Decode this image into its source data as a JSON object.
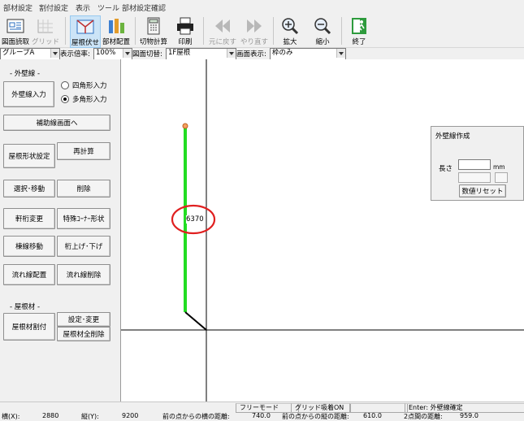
{
  "menubar": {
    "items": [
      "部材設定",
      "割付設定",
      "表示",
      "ツール",
      "部材設定確認"
    ]
  },
  "toolbar": {
    "buttons": [
      {
        "label": "図面読取",
        "icon": "drawing-read-icon",
        "state": "normal"
      },
      {
        "label": "グリッド",
        "icon": "grid-icon",
        "state": "disabled"
      },
      {
        "label": "屋根伏せ",
        "icon": "roof-plan-icon",
        "state": "pressed"
      },
      {
        "label": "部材配置",
        "icon": "member-placement-icon",
        "state": "normal"
      },
      {
        "label": "切物計算",
        "icon": "cut-calc-icon",
        "state": "normal"
      },
      {
        "label": "印刷",
        "icon": "printer-icon",
        "state": "normal"
      },
      {
        "label": "元に戻す",
        "icon": "undo-icon",
        "state": "disabled"
      },
      {
        "label": "やり直す",
        "icon": "redo-icon",
        "state": "disabled"
      },
      {
        "label": "拡大",
        "icon": "zoom-in-icon",
        "state": "normal"
      },
      {
        "label": "縮小",
        "icon": "zoom-out-icon",
        "state": "normal"
      },
      {
        "label": "終了",
        "icon": "exit-icon",
        "state": "normal"
      }
    ]
  },
  "combos": {
    "group": "グループA",
    "scale_label": "表示倍率:",
    "scale_value": "100%",
    "drawing_label": "図面切替:",
    "drawing_value": "1F屋根",
    "display_label": "画面表示:",
    "display_value": "枠のみ"
  },
  "leftpanel": {
    "wall_group_title": "- 外壁線 -",
    "wall_input": "外壁線入力",
    "radio_rect": "四角形入力",
    "radio_poly": "多角形入力",
    "aux_button": "補助線画面へ",
    "roof_shape": "屋根形状設定",
    "recalc": "再計算",
    "select_move": "選択･移動",
    "delete": "削除",
    "eave_change": "軒桁変更",
    "corner_shape": "特殊ｺｰﾅｰ形状",
    "ridge_move": "棟線移動",
    "beam_updown": "桁上げ･下げ",
    "flow_place": "流れ線配置",
    "flow_delete": "流れ線削除",
    "roofmat_title": "- 屋根材 -",
    "roofmat_alloc": "屋根材割付",
    "setting_change": "設定･変更",
    "roofmat_delete_all": "屋根材全削除"
  },
  "canvas": {
    "dimension_label": "6370",
    "colors": {
      "wall_line": "#22dd22",
      "highlight_circle": "#e02020",
      "axis": "#000000"
    }
  },
  "dialog": {
    "title": "外壁線作成",
    "length_label": "長さ",
    "unit": "mm",
    "reset_button": "数値リセット"
  },
  "statusbar": {
    "mode": "フリーモード",
    "grid_snap": "グリッド吸着ON",
    "hint": "Enter: 外壁線確定",
    "x_label": "横(X):",
    "x_value": "2880",
    "y_label": "縦(Y):",
    "y_value": "9200",
    "dx_label": "前の点からの横の距離:",
    "dx_value": "740.0",
    "dy_label": "前の点からの縦の距離:",
    "dy_value": "610.0",
    "d_label": "2点間の距離:",
    "d_value": "959.0"
  }
}
